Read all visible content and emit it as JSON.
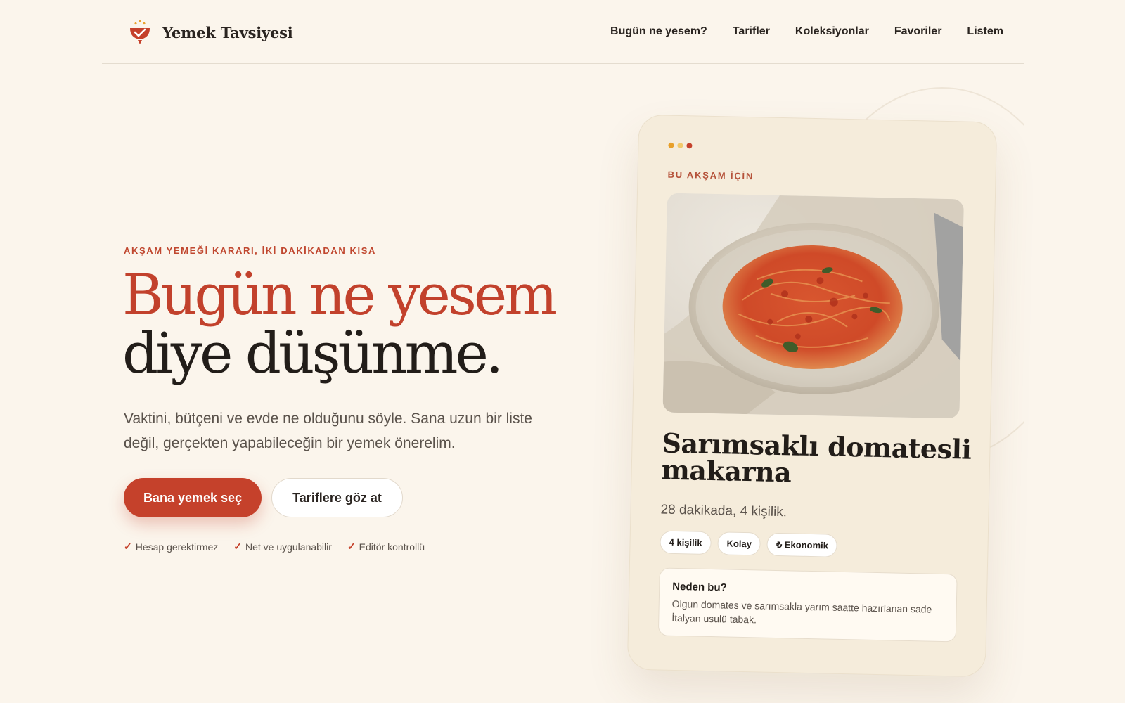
{
  "header": {
    "brand": "Yemek Tavsiyesi",
    "nav": [
      "Bugün ne yesem?",
      "Tarifler",
      "Koleksiyonlar",
      "Favoriler",
      "Listem"
    ]
  },
  "hero": {
    "eyebrow": "AKŞAM YEMEĞİ KARARI, İKİ DAKİKADAN KISA",
    "headline_line1": "Bugün ne yesem",
    "headline_line2": "diye düşünme.",
    "lead": "Vaktini, bütçeni ve evde ne olduğunu söyle. Sana uzun bir liste değil, gerçekten yapabileceğin bir yemek önerelim.",
    "primary_cta": "Bana yemek seç",
    "secondary_cta": "Tariflere göz at",
    "badges": [
      "Hesap gerektirmez",
      "Net ve uygulanabilir",
      "Editör kontrollü"
    ]
  },
  "card": {
    "eyebrow": "BU AKŞAM İÇİN",
    "title": "Sarımsaklı domatesli makarna",
    "meta": "28 dakikada, 4 kişilik.",
    "tags": [
      "4 kişilik",
      "Kolay",
      "₺ Ekonomik"
    ],
    "why_title": "Neden bu?",
    "why_text": "Olgun domates ve sarımsakla yarım saatte hazırlanan sade İtalyan usulü tabak.",
    "dot_colors": [
      "#e8a02a",
      "#f2c96a",
      "#c5412b"
    ]
  },
  "colors": {
    "accent": "#c5412b",
    "background": "#fbf5ec",
    "card": "#f5ecdb"
  },
  "icons": {
    "logo": "bowl-check-icon",
    "check": "check-icon"
  }
}
